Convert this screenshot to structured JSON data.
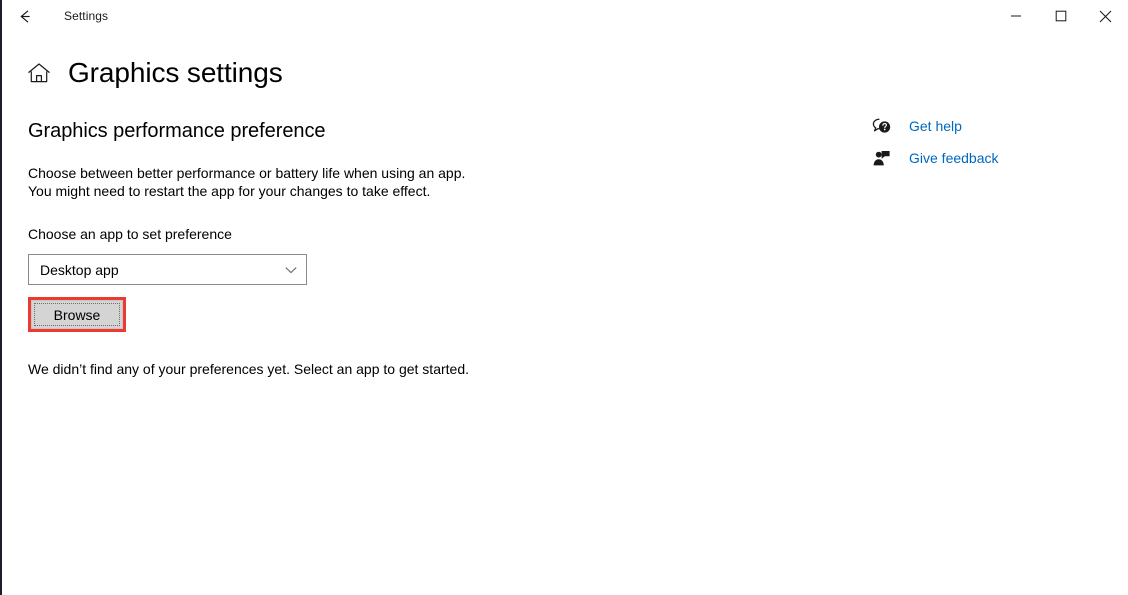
{
  "window": {
    "titlebar_title": "Settings",
    "back_icon": "back-arrow-icon",
    "minimize_icon": "minimize-icon",
    "maximize_icon": "maximize-icon",
    "close_icon": "close-icon"
  },
  "header": {
    "home_icon": "home-icon",
    "title": "Graphics settings"
  },
  "main": {
    "section_heading": "Graphics performance preference",
    "description_line1": "Choose between better performance or battery life when using an app.",
    "description_line2": "You might need to restart the app for your changes to take effect.",
    "app_picker_label": "Choose an app to set preference",
    "app_select_value": "Desktop app",
    "app_select_chevron_icon": "chevron-down-icon",
    "browse_button_label": "Browse",
    "empty_state_text": "We didn’t find any of your preferences yet. Select an app to get started."
  },
  "right_rail": {
    "links": [
      {
        "label": "Get help",
        "icon": "help-bubble-icon"
      },
      {
        "label": "Give feedback",
        "icon": "feedback-person-icon"
      }
    ]
  },
  "colors": {
    "link_blue": "#0067c0",
    "highlight_red": "#ec3a31",
    "button_face": "#d4d4d4",
    "window_border": "#1b1f2a",
    "select_border": "#8a8a8a"
  }
}
